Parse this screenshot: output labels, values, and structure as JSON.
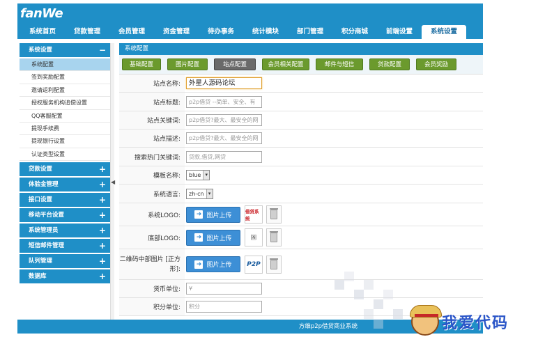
{
  "app": {
    "logo": "fanWe"
  },
  "nav": {
    "items": [
      "系统首页",
      "贷款管理",
      "会员管理",
      "资金管理",
      "待办事务",
      "统计模块",
      "部门管理",
      "积分商城",
      "前端设置",
      "系统设置"
    ],
    "active_index": 9
  },
  "sidebar": {
    "expanded_group": "系统设置",
    "expanded_items": [
      "系统配置",
      "签到奖励配置",
      "邀请返利配置",
      "授权服务机构追偿设置",
      "QQ客服配置",
      "提现手续费",
      "提现银行设置",
      "认证类型设置"
    ],
    "active_item": "系统配置",
    "collapsed_groups": [
      "贷款设置",
      "体验金管理",
      "接口设置",
      "移动平台设置",
      "系统管理员",
      "短信邮件管理",
      "队列管理",
      "数据库"
    ],
    "minus": "−",
    "plus": "+",
    "collapse_arrow": "◀"
  },
  "main": {
    "panel_title": "系统配置",
    "tabs": [
      "基础配置",
      "图片配置",
      "站点配置",
      "会员相关配置",
      "邮件与短信",
      "贷款配置",
      "会员奖励"
    ],
    "active_tab": "站点配置"
  },
  "form": {
    "site_name": {
      "label": "站点名称:",
      "value": "外星人源码论坛"
    },
    "site_title": {
      "label": "站点标题:",
      "value": "p2p借贷 --简单、安全、有"
    },
    "site_keywords": {
      "label": "站点关键词:",
      "value": "p2p借贷?最大、最安全的网"
    },
    "site_desc": {
      "label": "站点描述:",
      "value": "p2p借贷?最大、最安全的网"
    },
    "hot_search": {
      "label": "搜索热门关键词:",
      "value": "贷款,借贷,网贷"
    },
    "template": {
      "label": "模板名称:",
      "value": "blue",
      "caret": "▾"
    },
    "language": {
      "label": "系统语言:",
      "value": "zh-cn",
      "caret": "▾"
    },
    "system_logo": {
      "label": "系统LOGO:",
      "upload": "图片上传",
      "thumb_text": "借贷系统"
    },
    "footer_logo": {
      "label": "底部LOGO:",
      "upload": "图片上传",
      "thumb_text": "🖼"
    },
    "qr_image": {
      "label": "二维码中部图片 [正方形]:",
      "upload": "图片上传",
      "thumb_text": "P2P"
    },
    "currency_unit": {
      "label": "货币单位:",
      "value": "¥"
    },
    "points_unit": {
      "label": "积分单位:",
      "value": "积分"
    }
  },
  "footer": {
    "text": "方维p2p借贷商业系统"
  },
  "watermark": {
    "text": "我爱代码"
  }
}
